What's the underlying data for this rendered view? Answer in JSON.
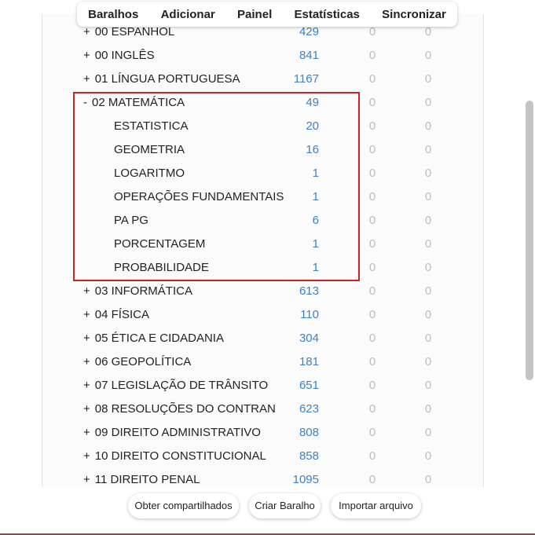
{
  "toolbar": {
    "items": [
      "Baralhos",
      "Adicionar",
      "Painel",
      "Estatísticas",
      "Sincronizar"
    ]
  },
  "decks": [
    {
      "expander": "+",
      "name": "00 ESPANHOL",
      "new": "429",
      "learn": "0",
      "due": "0",
      "sub": false
    },
    {
      "expander": "+",
      "name": "00 INGLÊS",
      "new": "841",
      "learn": "0",
      "due": "0",
      "sub": false
    },
    {
      "expander": "+",
      "name": "01 LÍNGUA PORTUGUESA",
      "new": "1167",
      "learn": "0",
      "due": "0",
      "sub": false
    },
    {
      "expander": "-",
      "name": "02 MATEMÁTICA",
      "new": "49",
      "learn": "0",
      "due": "0",
      "sub": false
    },
    {
      "expander": "",
      "name": "ESTATISTICA",
      "new": "20",
      "learn": "0",
      "due": "0",
      "sub": true
    },
    {
      "expander": "",
      "name": "GEOMETRIA",
      "new": "16",
      "learn": "0",
      "due": "0",
      "sub": true
    },
    {
      "expander": "",
      "name": "LOGARITMO",
      "new": "1",
      "learn": "0",
      "due": "0",
      "sub": true
    },
    {
      "expander": "",
      "name": "OPERAÇÕES FUNDAMENTAIS",
      "new": "1",
      "learn": "0",
      "due": "0",
      "sub": true
    },
    {
      "expander": "",
      "name": "PA PG",
      "new": "6",
      "learn": "0",
      "due": "0",
      "sub": true
    },
    {
      "expander": "",
      "name": "PORCENTAGEM",
      "new": "1",
      "learn": "0",
      "due": "0",
      "sub": true
    },
    {
      "expander": "",
      "name": "PROBABILIDADE",
      "new": "1",
      "learn": "0",
      "due": "0",
      "sub": true
    },
    {
      "expander": "+",
      "name": "03 INFORMÁTICA",
      "new": "613",
      "learn": "0",
      "due": "0",
      "sub": false
    },
    {
      "expander": "+",
      "name": "04 FÍSICA",
      "new": "110",
      "learn": "0",
      "due": "0",
      "sub": false
    },
    {
      "expander": "+",
      "name": "05 ÉTICA E CIDADANIA",
      "new": "304",
      "learn": "0",
      "due": "0",
      "sub": false
    },
    {
      "expander": "+",
      "name": "06 GEOPOLÍTICA",
      "new": "181",
      "learn": "0",
      "due": "0",
      "sub": false
    },
    {
      "expander": "+",
      "name": "07 LEGISLAÇÃO DE TRÂNSITO",
      "new": "651",
      "learn": "0",
      "due": "0",
      "sub": false
    },
    {
      "expander": "+",
      "name": "08 RESOLUÇÕES DO CONTRAN",
      "new": "623",
      "learn": "0",
      "due": "0",
      "sub": false
    },
    {
      "expander": "+",
      "name": "09 DIREITO ADMINISTRATIVO",
      "new": "808",
      "learn": "0",
      "due": "0",
      "sub": false
    },
    {
      "expander": "+",
      "name": "10 DIREITO CONSTITUCIONAL",
      "new": "858",
      "learn": "0",
      "due": "0",
      "sub": false
    },
    {
      "expander": "+",
      "name": "11 DIREITO PENAL",
      "new": "1095",
      "learn": "0",
      "due": "0",
      "sub": false
    }
  ],
  "footer": {
    "shared_label": "Obter compartilhados",
    "create_label": "Criar Baralho",
    "import_label": "Importar arquivo"
  },
  "colors": {
    "count_new": "#3a82c9",
    "count_zero": "#bcbcbc",
    "highlight": "#d42020"
  }
}
